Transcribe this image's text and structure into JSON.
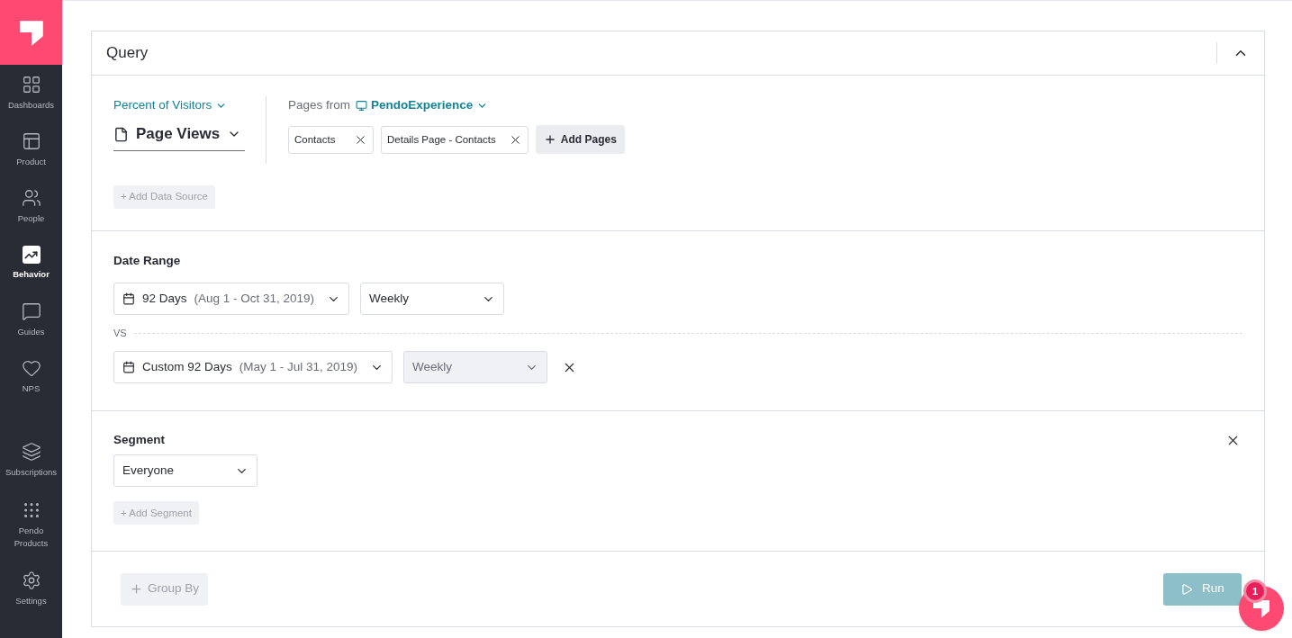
{
  "sidebar": {
    "items": [
      {
        "label": "Dashboards",
        "selected": false
      },
      {
        "label": "Product",
        "selected": false
      },
      {
        "label": "People",
        "selected": false
      },
      {
        "label": "Behavior",
        "selected": true
      },
      {
        "label": "Guides",
        "selected": false
      },
      {
        "label": "NPS",
        "selected": false
      },
      {
        "label": "Subscriptions",
        "selected": false
      },
      {
        "label": "Pendo Products",
        "selected": false
      },
      {
        "label": "Settings",
        "selected": false
      }
    ]
  },
  "query": {
    "title": "Query",
    "expanded": true,
    "metric": "Percent of Visitors",
    "source": "Page Views",
    "pages_from_label": "Pages from",
    "app": "PendoExperience",
    "pages": [
      "Contacts",
      "Details Page - Contacts"
    ],
    "add_pages": "Add Pages",
    "add_data_source": "+ Add Data Source"
  },
  "date_range": {
    "title": "Date Range",
    "ranges": [
      {
        "label": "92 Days",
        "dates": "(Aug 1 - Oct 31, 2019)",
        "interval": "Weekly",
        "disabled": false,
        "removable": false
      },
      {
        "label": "Custom 92 Days",
        "dates": "(May 1 - Jul 31, 2019)",
        "interval": "Weekly",
        "disabled": true,
        "removable": true
      }
    ],
    "vs": "VS"
  },
  "segment": {
    "title": "Segment",
    "value": "Everyone",
    "add": "+ Add Segment"
  },
  "footer": {
    "group_by": "Group By",
    "run": "Run",
    "run_disabled": true
  },
  "launcher": {
    "badge": "1"
  }
}
